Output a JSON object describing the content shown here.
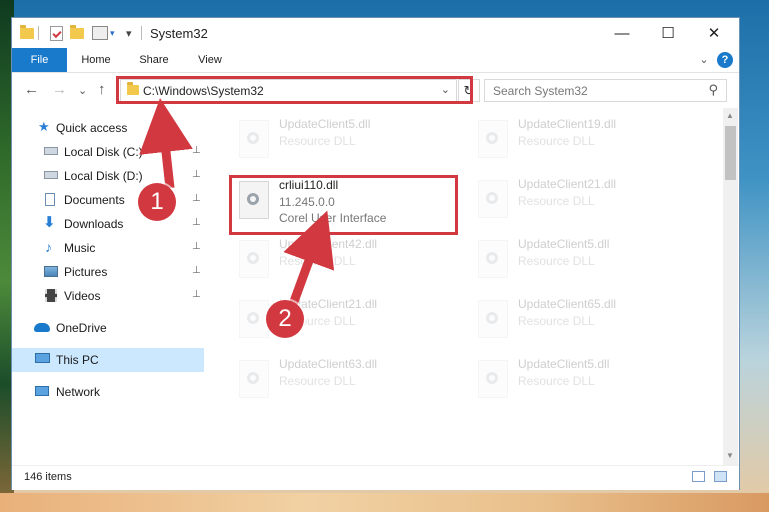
{
  "window": {
    "title": "System32",
    "controls": {
      "minimize": "—",
      "maximize": "☐",
      "close": "✕"
    }
  },
  "ribbon": {
    "tabs": [
      "File",
      "Home",
      "Share",
      "View"
    ],
    "expand": "⌄",
    "help": "?"
  },
  "nav": {
    "back": "←",
    "forward": "→",
    "recent": "⌄",
    "up": "↑",
    "address": "C:\\Windows\\System32",
    "dropdown": "⌄",
    "refresh": "↻",
    "search_placeholder": "Search System32",
    "search_icon": "⚲"
  },
  "sidebar": {
    "items": [
      {
        "label": "Quick access",
        "icon": "star-icon",
        "pinned": false
      },
      {
        "label": "Local Disk (C:)",
        "icon": "disk-icon",
        "pinned": true
      },
      {
        "label": "Local Disk (D:)",
        "icon": "disk-icon",
        "pinned": true
      },
      {
        "label": "Documents",
        "icon": "documents-icon",
        "pinned": true
      },
      {
        "label": "Downloads",
        "icon": "download-icon",
        "pinned": true
      },
      {
        "label": "Music",
        "icon": "music-icon",
        "pinned": true
      },
      {
        "label": "Pictures",
        "icon": "pictures-icon",
        "pinned": true
      },
      {
        "label": "Videos",
        "icon": "videos-icon",
        "pinned": true
      },
      {
        "label": "OneDrive",
        "icon": "cloud-icon",
        "pinned": false
      },
      {
        "label": "This PC",
        "icon": "computer-icon",
        "pinned": false,
        "selected": true
      },
      {
        "label": "Network",
        "icon": "network-icon",
        "pinned": false
      }
    ],
    "pin_glyph": "📌"
  },
  "files": {
    "left": [
      {
        "name": "UpdateClient5.dll",
        "line1": "Resource DLL",
        "line2": "",
        "faded": true
      },
      {
        "name": "crliui110.dll",
        "line1": "11.245.0.0",
        "line2": "Corel User Interface",
        "faded": false
      },
      {
        "name": "UpdateClient42.dll",
        "line1": "Resource DLL",
        "line2": "",
        "faded": true
      },
      {
        "name": "UpdateClient21.dll",
        "line1": "Resource DLL",
        "line2": "",
        "faded": true
      },
      {
        "name": "UpdateClient63.dll",
        "line1": "Resource DLL",
        "line2": "",
        "faded": true
      }
    ],
    "right": [
      {
        "name": "UpdateClient19.dll",
        "line1": "Resource DLL",
        "faded": true
      },
      {
        "name": "UpdateClient21.dll",
        "line1": "Resource DLL",
        "faded": true
      },
      {
        "name": "UpdateClient5.dll",
        "line1": "Resource DLL",
        "faded": true
      },
      {
        "name": "UpdateClient65.dll",
        "line1": "Resource DLL",
        "faded": true
      },
      {
        "name": "UpdateClient5.dll",
        "line1": "Resource DLL",
        "faded": true
      }
    ]
  },
  "status": {
    "count": "146 items"
  },
  "callouts": {
    "one": "1",
    "two": "2"
  },
  "colors": {
    "accent": "#1979ca",
    "highlight": "#d2383f",
    "selected": "#cce8ff"
  }
}
